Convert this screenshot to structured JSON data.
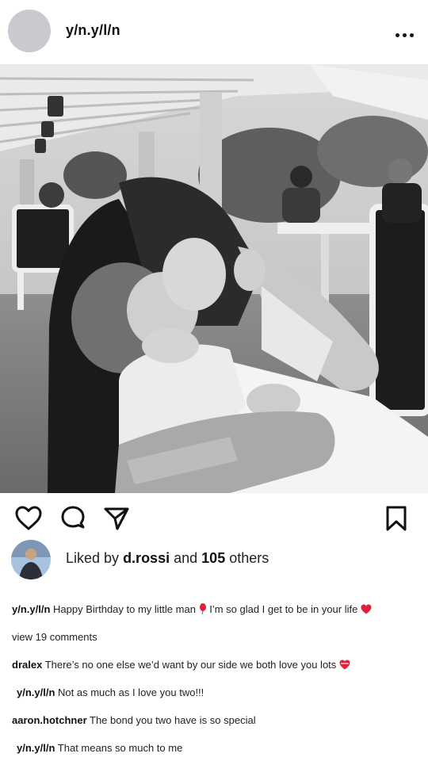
{
  "post": {
    "username": "y/n.y/l/n",
    "likes": {
      "prefix": "Liked by",
      "user": "d.rossi",
      "connector": "and",
      "count": "105",
      "suffix": "others"
    },
    "caption": {
      "username": "y/n.y/l/n",
      "text_before_icon": "Happy Birthday to my little man",
      "text_after_icon": "I’m so glad I get to be in your life"
    },
    "view_comments": "view 19 comments",
    "comments": [
      {
        "username": "dralex",
        "text": "There’s no one else we’d want by our side we both love you lots"
      },
      {
        "username": "y/n.y/l/n",
        "text": "Not as much as I love you two!!!"
      },
      {
        "username": "aaron.hotchner",
        "text": "The bond you two have is so special"
      },
      {
        "username": "y/n.y/l/n",
        "text": "That means so much to me"
      }
    ]
  },
  "icons": {
    "more": "more-horizontal-icon",
    "like": "heart-outline-icon",
    "comment": "comment-bubble-icon",
    "share": "paper-plane-icon",
    "save": "bookmark-icon",
    "caption_emoji_1": "balloon-icon",
    "caption_emoji_2": "red-heart-icon",
    "comment_emoji": "heart-ribbon-icon"
  },
  "colors": {
    "text": "#111111",
    "emoji_red": "#e0203a",
    "avatar_placeholder": "#c8cacf"
  }
}
